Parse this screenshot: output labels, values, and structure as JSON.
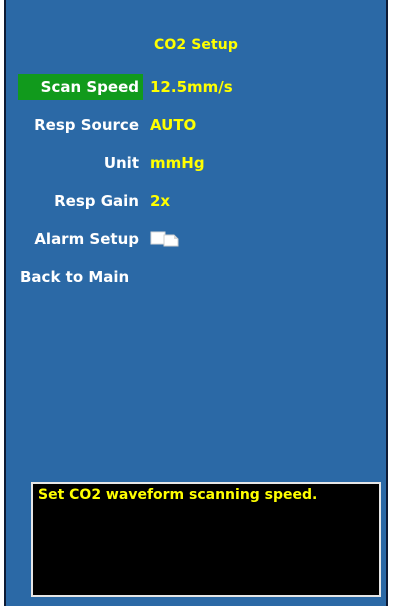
{
  "title": "CO2 Setup",
  "menu": {
    "scan_speed": {
      "label": "Scan Speed",
      "value": "12.5mm/s"
    },
    "resp_source": {
      "label": "Resp Source",
      "value": "AUTO"
    },
    "unit": {
      "label": "Unit",
      "value": "mmHg"
    },
    "resp_gain": {
      "label": "Resp Gain",
      "value": "2x"
    },
    "alarm_setup": {
      "label": "Alarm Setup",
      "icon": "copy-pages-icon"
    },
    "back": {
      "label": "Back to Main"
    }
  },
  "help": {
    "text": "Set CO2 waveform scanning speed."
  },
  "colors": {
    "background": "#2b69a6",
    "selected": "#119a1c",
    "value_text": "#ffff00",
    "label_text": "#ffffff",
    "help_background": "#000000"
  }
}
